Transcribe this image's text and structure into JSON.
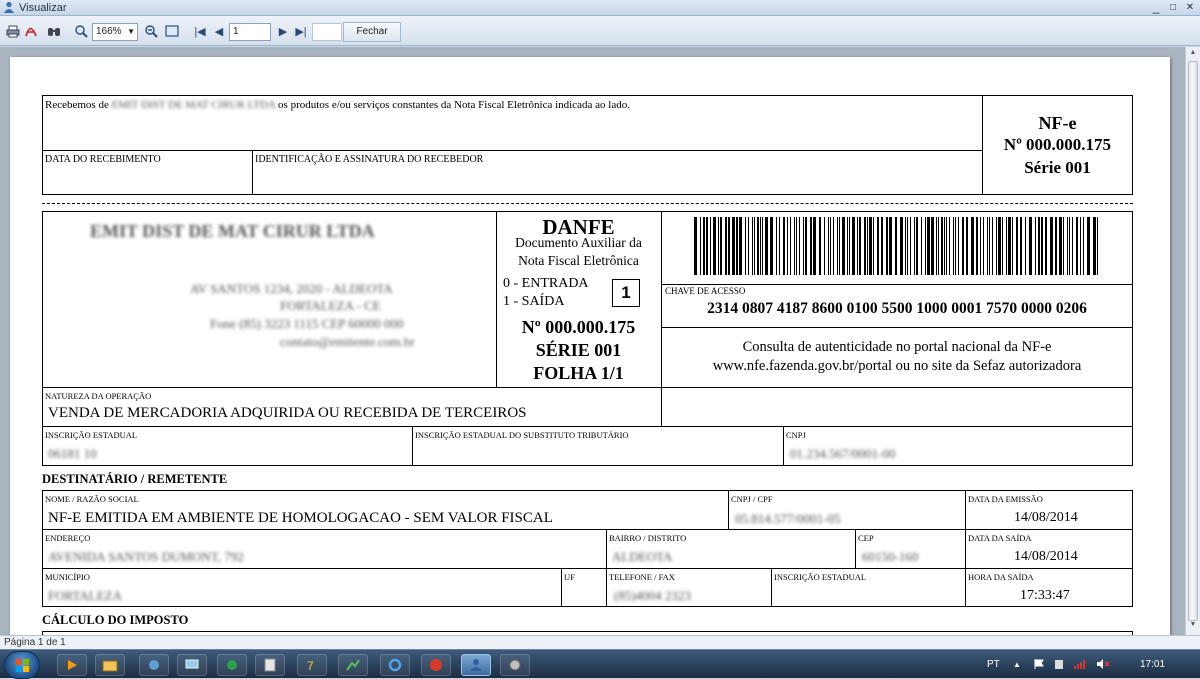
{
  "window": {
    "title": "Visualizar",
    "minimize": "_",
    "restore": "□",
    "close": "✕"
  },
  "toolbar": {
    "zoom": "166%",
    "page_input": "1",
    "close_label": "Fechar"
  },
  "status": {
    "page_info": "Página 1 de 1"
  },
  "canhoto": {
    "received_prefix": "Recebemos de",
    "received_suffix": "os produtos e/ou serviços constantes da Nota Fiscal Eletrônica indicada ao lado.",
    "date_label": "DATA DO RECEBIMENTO",
    "signature_label": "IDENTIFICAÇÃO E ASSINATURA DO RECEBEDOR",
    "nfe_title": "NF-e",
    "nfe_number": "Nº 000.000.175",
    "nfe_series": "Série 001"
  },
  "danfe": {
    "title": "DANFE",
    "subtitle1": "Documento Auxiliar da",
    "subtitle2": "Nota Fiscal Eletrônica",
    "entry": "0 - ENTRADA",
    "exit": "1 - SAÍDA",
    "type_value": "1",
    "number": "Nº 000.000.175",
    "series": "SÉRIE 001",
    "sheet": "FOLHA 1/1",
    "access_key_label": "CHAVE DE ACESSO",
    "access_key": "2314 0807 4187 8600 0100 5500 1000 0001 7570 0000 0206",
    "consult1": "Consulta de autenticidade no portal nacional da NF-e",
    "consult2": "www.nfe.fazenda.gov.br/portal ou no site da Sefaz autorizadora",
    "nature_label": "NATUREZA DA OPERAÇÃO",
    "nature_value": "VENDA DE MERCADORIA ADQUIRIDA OU RECEBIDA DE TERCEIROS",
    "ie_label": "INSCRIÇÃO ESTADUAL",
    "ie_st_label": "INSCRIÇÃO ESTADUAL DO SUBSTITUTO TRIBUTÁRIO",
    "cnpj_label": "CNPJ"
  },
  "recipient": {
    "section_title": "DESTINATÁRIO / REMETENTE",
    "name_label": "NOME / RAZÃO SOCIAL",
    "name_value": "NF-E EMITIDA EM AMBIENTE DE HOMOLOGACAO - SEM VALOR FISCAL",
    "cnpj_label": "CNPJ / CPF",
    "emission_label": "DATA DA EMISSÃO",
    "emission_value": "14/08/2014",
    "address_label": "ENDEREÇO",
    "district_label": "BAIRRO / DISTRITO",
    "cep_label": "CEP",
    "exit_date_label": "DATA DA SAÍDA",
    "exit_date_value": "14/08/2014",
    "city_label": "MUNICÍPIO",
    "uf_label": "UF",
    "phone_label": "TELEFONE / FAX",
    "state_reg_label": "INSCRIÇÃO ESTADUAL",
    "exit_time_label": "HORA DA SAÍDA",
    "exit_time_value": "17:33:47"
  },
  "tax": {
    "section_title": "CÁLCULO DO IMPOSTO"
  },
  "taskbar": {
    "language": "PT",
    "clock": "17:01"
  }
}
